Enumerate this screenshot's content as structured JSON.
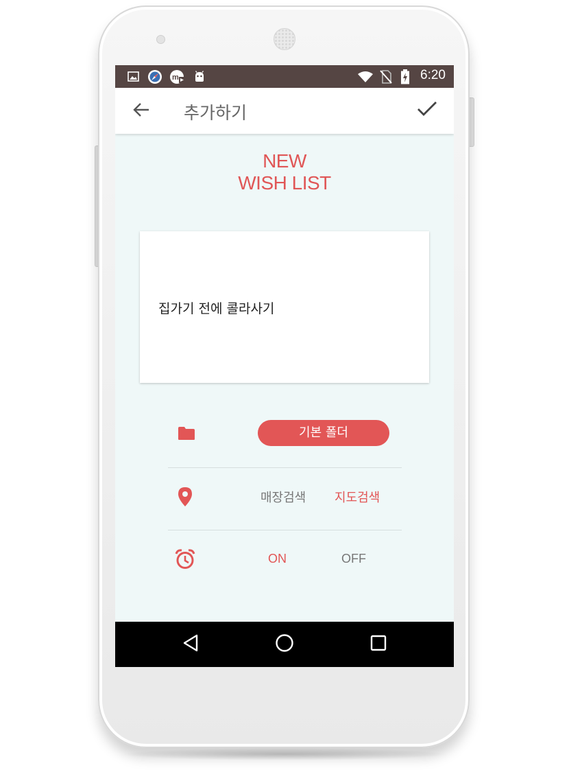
{
  "status_bar": {
    "time": "6:20",
    "left_icons": [
      "image-icon",
      "compass-icon",
      "media-icon",
      "android-icon"
    ],
    "right_icons": [
      "wifi-icon",
      "no-sim-icon",
      "battery-charging-icon"
    ]
  },
  "app_bar": {
    "title": "추가하기",
    "back_icon": "arrow-left-icon",
    "confirm_icon": "check-icon"
  },
  "headline": {
    "line1": "NEW",
    "line2": "WISH LIST"
  },
  "memo": {
    "text": "집가기 전에 콜라사기"
  },
  "folder_row": {
    "icon": "folder-icon",
    "button_label": "기본 폴더"
  },
  "location_row": {
    "icon": "location-pin-icon",
    "option_store": "매장검색",
    "option_map": "지도검색",
    "selected": "지도검색"
  },
  "alarm_row": {
    "icon": "alarm-clock-icon",
    "option_on": "ON",
    "option_off": "OFF",
    "selected": "ON"
  },
  "colors": {
    "accent": "#e25656",
    "status_bar": "#554543",
    "screen_background": "#eff8f8",
    "inactive_text": "#777777"
  },
  "nav_bar": {
    "icons": [
      "back-triangle-icon",
      "home-circle-icon",
      "recents-square-icon"
    ]
  }
}
